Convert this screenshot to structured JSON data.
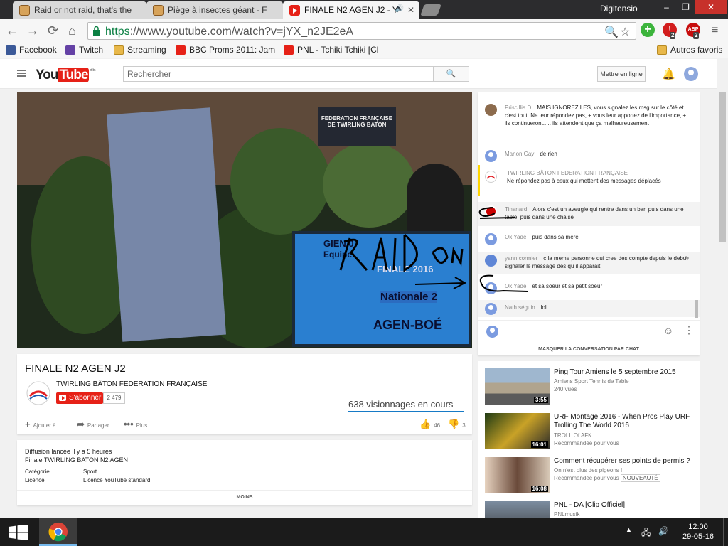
{
  "browser": {
    "tabs": [
      {
        "title": "Raid or not raid, that's the",
        "icon": "dog-face-icon"
      },
      {
        "title": "Piège à insectes géant - F",
        "icon": "dog-face-icon"
      },
      {
        "title": "FINALE N2 AGEN J2 - Y",
        "icon": "youtube-icon"
      }
    ],
    "window_user": "Digitensio",
    "url_scheme": "https",
    "url_rest": "://www.youtube.com/watch?v=jYX_n2JE2eA",
    "ext_badge": "2",
    "abp_label": "ABP",
    "bookmarks": [
      "Facebook",
      "Twitch",
      "Streaming",
      "BBC Proms 2011: Jam",
      "PNL - Tchiki Tchiki [Cl"
    ],
    "other_bookmarks": "Autres favoris"
  },
  "yt": {
    "logo_you": "You",
    "logo_tube": "Tube",
    "region": "BE",
    "search_placeholder": "Rechercher",
    "mettre_en_ligne": "Mettre en ligne"
  },
  "video": {
    "title": "FINALE N2 AGEN J2",
    "channel": "TWIRLING BÂTON FEDERATION FRANÇAISE",
    "subscribe": "S'abonner",
    "subs": "2 479",
    "views": "638 visionnages en cours",
    "add": "Ajouter à",
    "share": "Partager",
    "more": "Plus",
    "likes": "46",
    "dislikes": "3",
    "scene": {
      "sign": "FEDERATION FRANÇAISE DE TWIRLING BATON",
      "screen_l1": "GIEN 0",
      "screen_l2": "Equipe",
      "screen_l3": "FINALE 2016",
      "screen_l4": "Nationale 2",
      "screen_l5": "AGEN-BOÉ",
      "doodle": "RAID ON"
    }
  },
  "description": {
    "started": "Diffusion lancée il y a 5 heures",
    "text": "Finale TWIRLING BATON N2 AGEN",
    "cat_label": "Catégorie",
    "cat_value": "Sport",
    "lic_label": "Licence",
    "lic_value": "Licence YouTube standard",
    "less": "MOINS"
  },
  "chat": {
    "messages": [
      {
        "author": "Priscillia D",
        "text": "MAIS IGNOREZ LES, vous signalez les msg sur le côté et c'est tout. Ne leur répondez pas, + vous leur apportez de l'importance, + ils continueront..... ils attendent que ça malheureusement"
      },
      {
        "author": "Manon Gay",
        "text": "de rien"
      },
      {
        "author": "TWIRLING BÂTON FEDERATION FRANÇAISE",
        "text": "Ne répondez pas à ceux qui mettent des messages déplacés"
      },
      {
        "author": "Tinanard",
        "text": "Alors c'est un aveugle qui rentre dans un bar, puis dans une table, puis dans une chaise"
      },
      {
        "author": "Ok Yade",
        "text": "puis dans sa mere"
      },
      {
        "author": "yann cormier",
        "text": "c la meme personne qui cree des compte depuis le debut signaler le message des qu il apparait"
      },
      {
        "author": "Ok Yade",
        "text": "et sa soeur et sa petit soeur"
      },
      {
        "author": "Nath séguin",
        "text": "lol"
      }
    ],
    "hide": "MASQUER LA CONVERSATION PAR CHAT"
  },
  "related": [
    {
      "title": "Ping Tour Amiens le 5 septembre 2015",
      "channel": "Amiens Sport Tennis de Table",
      "meta": "240 vues",
      "duration": "3:55"
    },
    {
      "title": "URF Montage 2016 - When Pros Play URF Trolling The World 2016",
      "channel": "TROLL Of AFK",
      "meta": "Recommandée pour vous",
      "duration": "16:01"
    },
    {
      "title": "Comment récupérer ses points de permis ?",
      "channel": "On n'est plus des pigeons !",
      "meta": "Recommandée pour vous",
      "badge": "NOUVEAUTÉ",
      "duration": "16:08"
    },
    {
      "title": "PNL - DA [Clip Officiel]",
      "channel": "PNLmusik",
      "meta": "",
      "duration": ""
    }
  ],
  "taskbar": {
    "time": "12:00",
    "date": "29-05-16"
  }
}
